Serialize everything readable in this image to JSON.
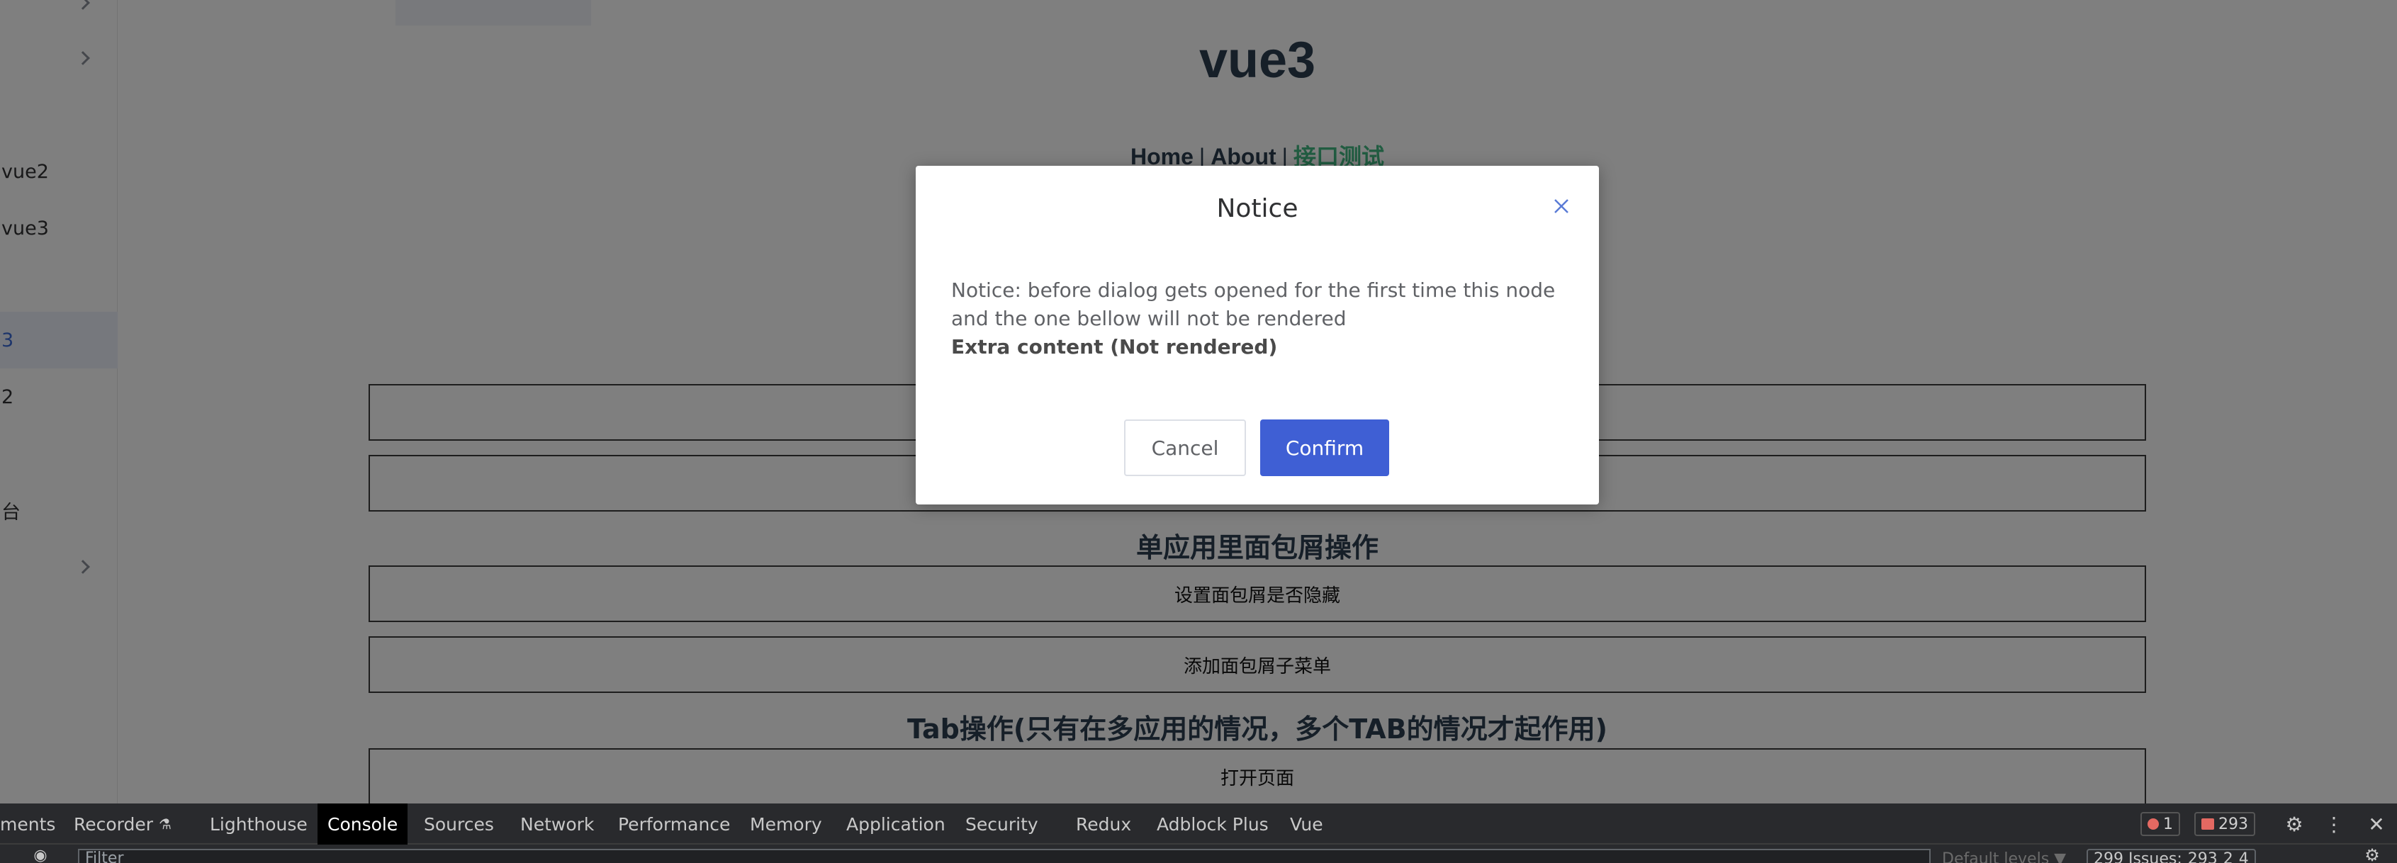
{
  "sidebar": {
    "items": [
      {
        "label": "",
        "chevron": true
      },
      {
        "label": "",
        "chevron": true
      },
      {
        "label": "vue2",
        "chevron": false
      },
      {
        "label": "vue3",
        "chevron": false
      },
      {
        "label": "",
        "chevron": false
      },
      {
        "label": "3",
        "chevron": false,
        "active": true
      },
      {
        "label": "2",
        "chevron": false
      },
      {
        "label": "",
        "chevron": false
      },
      {
        "label": "台",
        "chevron": false
      },
      {
        "label": "",
        "chevron": true
      }
    ]
  },
  "main": {
    "title": "vue3",
    "nav": {
      "home": "Home",
      "about": "About",
      "api_test": "接口测试",
      "separator": "|"
    },
    "breadcrumb_section_title": "单应用里面包屑操作",
    "buttons": {
      "hide_breadcrumb": "设置面包屑是否隐藏",
      "add_breadcrumb_submenu": "添加面包屑子菜单",
      "open_page": "打开页面"
    },
    "tab_section_title": "Tab操作(只有在多应用的情况，多个TAB的情况才起作用)"
  },
  "dialog": {
    "title": "Notice",
    "body_text": "Notice: before dialog gets opened for the first time this node and the one bellow will not be rendered",
    "extra_text": "Extra content (Not rendered)",
    "cancel_label": "Cancel",
    "confirm_label": "Confirm",
    "confirm_color": "#3f5fd4"
  },
  "devtools": {
    "tabs": [
      "ments",
      "Recorder",
      "Lighthouse",
      "Console",
      "Sources",
      "Network",
      "Performance",
      "Memory",
      "Application",
      "Security",
      "Redux",
      "Adblock Plus",
      "Vue"
    ],
    "selected_tab": "Console",
    "error_count": "1",
    "issue_count": "293",
    "filter_placeholder": "Filter",
    "levels_label": "Default levels ▼",
    "issues_label": "299 Issues:",
    "issues_errors": "293",
    "issues_warnings": "2",
    "issues_info": "4"
  }
}
